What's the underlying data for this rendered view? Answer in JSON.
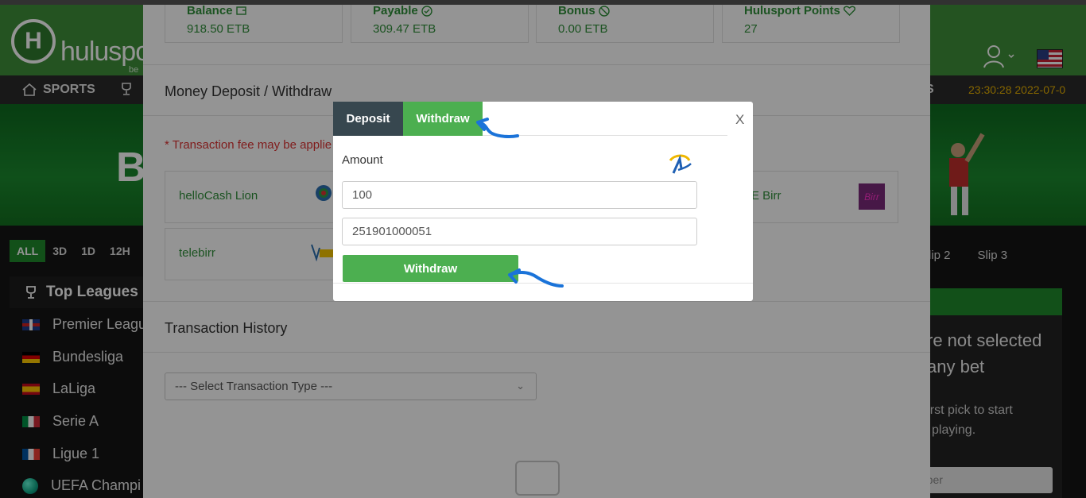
{
  "header": {
    "logo_letter": "H",
    "logo_text": "hulusport",
    "logo_sub": "be",
    "nav_sports": "SPORTS",
    "nav_right": "S",
    "clock": "23:30:28 2022-07-0"
  },
  "banner": {
    "letter": "B"
  },
  "filters": {
    "tabs": [
      "ALL",
      "3D",
      "1D",
      "12H"
    ]
  },
  "leagues": {
    "title": "Top Leagues",
    "items": [
      "Premier Leagu",
      "Bundesliga",
      "LaLiga",
      "Serie A",
      "Ligue 1",
      "UEFA Champi"
    ]
  },
  "betslip": {
    "tabs": [
      "lip 2",
      "Slip 3"
    ],
    "title_line1": "re not selected",
    "title_line2": "any bet",
    "sub_line1": "r first pick to start",
    "sub_line2": "playing.",
    "input_placeholder": "mber"
  },
  "account": {
    "stats": [
      {
        "label": "Balance",
        "value": "918.50 ETB"
      },
      {
        "label": "Payable",
        "value": "309.47 ETB"
      },
      {
        "label": "Bonus",
        "value": "0.00 ETB"
      },
      {
        "label": "Hulusport Points",
        "value": "27"
      }
    ],
    "deposit_title": "Money Deposit / Withdraw",
    "fee_note": "* Transaction fee may be applie",
    "methods": [
      "helloCash Lion",
      "telebirr",
      "E Birr"
    ],
    "history_title": "Transaction History",
    "select_placeholder": "--- Select Transaction Type ---"
  },
  "modal": {
    "tab_deposit": "Deposit",
    "tab_withdraw": "Withdraw",
    "close": "X",
    "amount_label": "Amount",
    "amount_value": "100",
    "phone_value": "251901000051",
    "submit_label": "Withdraw"
  },
  "colors": {
    "brand_green": "#4caf50",
    "dark_tab": "#37474f",
    "annotation_arrow": "#1a73d9"
  }
}
